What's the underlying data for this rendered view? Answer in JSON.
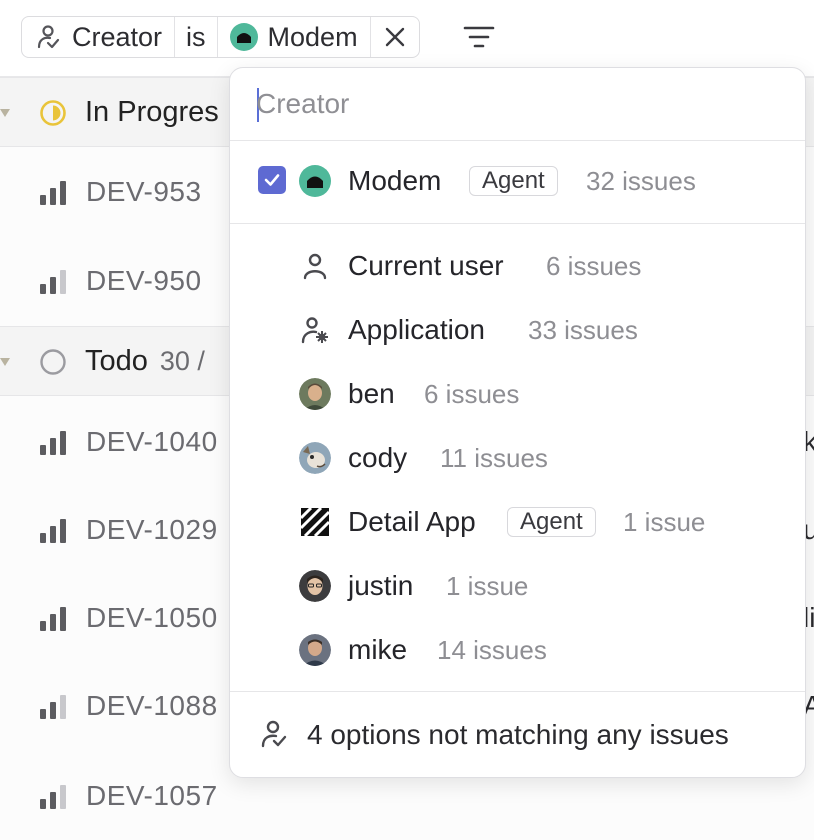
{
  "filter": {
    "field": "Creator",
    "operator": "is",
    "value": "Modem",
    "icons": {
      "field": "creator-icon",
      "clear": "close-icon",
      "display": "filter-lines-icon"
    }
  },
  "list": {
    "groups": [
      {
        "title": "In Progres",
        "count": "",
        "icon": "in-progress-icon",
        "status_color": "#e9c43a"
      },
      {
        "title": "Todo",
        "count": "30 /",
        "icon": "todo-circle-icon",
        "status_color": "#9b9ba0"
      }
    ],
    "issues": [
      {
        "id": "DEV-953",
        "priority": "high-priority-icon",
        "right": ""
      },
      {
        "id": "DEV-950",
        "priority": "medium-priority-icon",
        "right": ""
      },
      {
        "id": "DEV-1040",
        "priority": "high-priority-icon",
        "right": "k"
      },
      {
        "id": "DEV-1029",
        "priority": "high-priority-icon",
        "right": "u"
      },
      {
        "id": "DEV-1050",
        "priority": "high-priority-icon",
        "right": "li"
      },
      {
        "id": "DEV-1088",
        "priority": "medium-priority-icon",
        "right": "A"
      },
      {
        "id": "DEV-1057",
        "priority": "medium-priority-icon",
        "right": ""
      }
    ]
  },
  "dropdown": {
    "search_placeholder": "Creator",
    "selected": [
      {
        "label": "Modem",
        "badge": "Agent",
        "count": "32 issues",
        "icon": "modem-avatar-icon",
        "checked": true
      }
    ],
    "options": [
      {
        "label": "Current user",
        "count": "6 issues",
        "icon": "user-icon"
      },
      {
        "label": "Application",
        "count": "33 issues",
        "icon": "application-user-icon"
      },
      {
        "label": "ben",
        "count": "6 issues",
        "icon": "ben-avatar-icon"
      },
      {
        "label": "cody",
        "count": "11 issues",
        "icon": "cody-avatar-icon"
      },
      {
        "label": "Detail App",
        "badge": "Agent",
        "count": "1 issue",
        "icon": "detail-app-logo-icon"
      },
      {
        "label": "justin",
        "count": "1 issue",
        "icon": "justin-avatar-icon"
      },
      {
        "label": "mike",
        "count": "14 issues",
        "icon": "mike-avatar-icon"
      }
    ],
    "footer": "4 options not matching any issues"
  },
  "colors": {
    "accent": "#5e6ad2",
    "modem_bg": "#4fb89a",
    "in_progress": "#e9c43a"
  }
}
